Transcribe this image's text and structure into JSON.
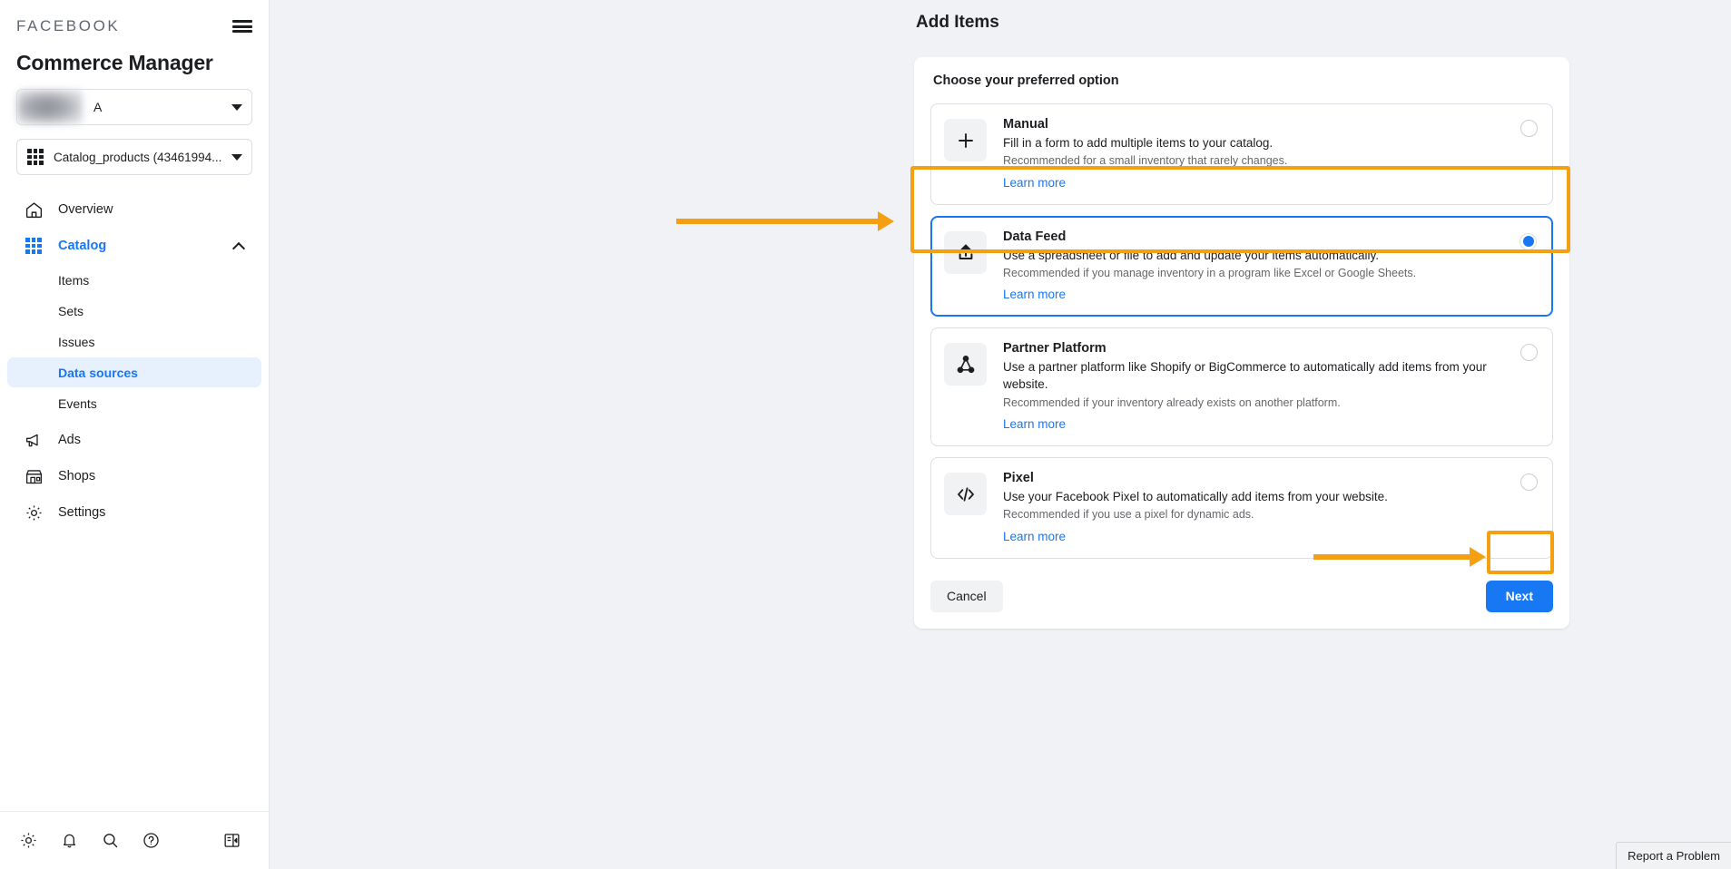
{
  "sidebar": {
    "brand": "FACEBOOK",
    "menu_icon": "hamburger-icon",
    "app_title": "Commerce Manager",
    "account_selector": {
      "label": "A"
    },
    "catalog_selector": {
      "label": "Catalog_products (43461994..."
    },
    "nav": [
      {
        "label": "Overview",
        "icon": "home-icon"
      },
      {
        "label": "Catalog",
        "icon": "grid-icon",
        "expanded": true,
        "children": [
          {
            "label": "Items"
          },
          {
            "label": "Sets"
          },
          {
            "label": "Issues"
          },
          {
            "label": "Data sources",
            "selected": true
          },
          {
            "label": "Events"
          }
        ]
      },
      {
        "label": "Ads",
        "icon": "megaphone-icon"
      },
      {
        "label": "Shops",
        "icon": "storefront-icon"
      },
      {
        "label": "Settings",
        "icon": "gear-icon"
      }
    ],
    "bottom_icons": [
      "gear-icon",
      "bell-icon",
      "search-icon",
      "help-icon",
      "collapse-panel-icon"
    ]
  },
  "main": {
    "page_title": "Add Items",
    "panel_heading": "Choose your preferred option",
    "options": [
      {
        "id": "manual",
        "icon": "plus-icon",
        "title": "Manual",
        "description": "Fill in a form to add multiple items to your catalog.",
        "recommendation": "Recommended for a small inventory that rarely changes.",
        "link": "Learn more",
        "selected": false
      },
      {
        "id": "data-feed",
        "icon": "upload-icon",
        "title": "Data Feed",
        "description": "Use a spreadsheet or file to add and update your items automatically.",
        "recommendation": "Recommended if you manage inventory in a program like Excel or Google Sheets.",
        "link": "Learn more",
        "selected": true
      },
      {
        "id": "partner-platform",
        "icon": "network-nodes-icon",
        "title": "Partner Platform",
        "description": "Use a partner platform like Shopify or BigCommerce to automatically add items from your website.",
        "recommendation": "Recommended if your inventory already exists on another platform.",
        "link": "Learn more",
        "selected": false
      },
      {
        "id": "pixel",
        "icon": "code-brackets-icon",
        "title": "Pixel",
        "description": "Use your Facebook Pixel to automatically add items from your website.",
        "recommendation": "Recommended if you use a pixel for dynamic ads.",
        "link": "Learn more",
        "selected": false
      }
    ],
    "cancel_label": "Cancel",
    "next_label": "Next"
  },
  "footer": {
    "report_label": "Report a Problem"
  },
  "colors": {
    "accent": "#1877f2",
    "highlight": "#f5a013",
    "selected_bg": "#e7f0fd"
  }
}
